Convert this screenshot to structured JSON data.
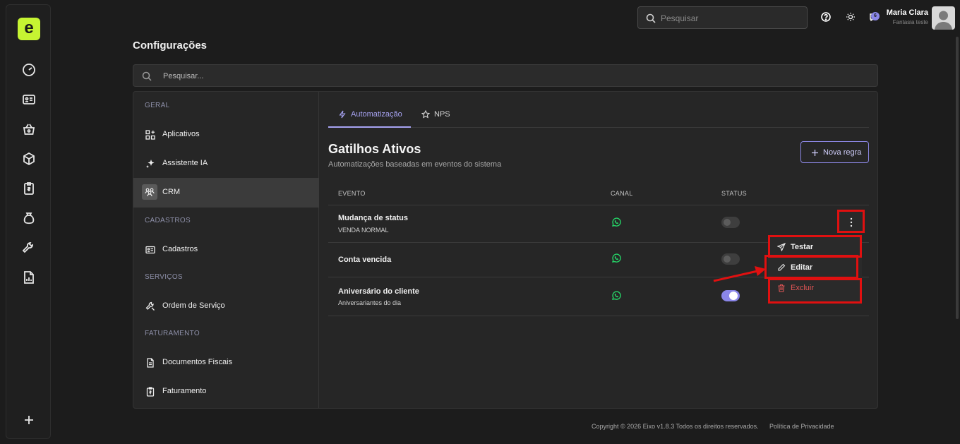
{
  "app": {
    "logo_letter": "e",
    "accent": "#c6f432",
    "purple": "#8a86e8"
  },
  "rail": {
    "items": [
      "dashboard-icon",
      "contact-card-icon",
      "basket-icon",
      "package-icon",
      "receipt-icon",
      "money-bag-icon",
      "wrench-icon",
      "report-icon"
    ],
    "add_icon": "plus-icon"
  },
  "topbar": {
    "search_placeholder": "Pesquisar",
    "notifications_count": "6",
    "user_name": "Maria Clara",
    "user_company": "Fantasia teste"
  },
  "page": {
    "title": "Configurações",
    "search_placeholder": "Pesquisar..."
  },
  "sidebar": {
    "sections": [
      {
        "label": "GERAL",
        "items": [
          {
            "label": "Aplicativos",
            "icon": "apps-icon"
          },
          {
            "label": "Assistente IA",
            "icon": "sparkles-icon"
          },
          {
            "label": "CRM",
            "icon": "users-icon",
            "active": true
          }
        ]
      },
      {
        "label": "CADASTROS",
        "items": [
          {
            "label": "Cadastros",
            "icon": "contact-card-icon"
          }
        ]
      },
      {
        "label": "SERVIÇOS",
        "items": [
          {
            "label": "Ordem de Serviço",
            "icon": "wrench-icon"
          }
        ]
      },
      {
        "label": "FATURAMENTO",
        "items": [
          {
            "label": "Documentos Fiscais",
            "icon": "document-icon"
          },
          {
            "label": "Faturamento",
            "icon": "receipt-icon"
          }
        ]
      }
    ]
  },
  "tabs": [
    {
      "label": "Automatização",
      "icon": "lightning-icon",
      "active": true
    },
    {
      "label": "NPS",
      "icon": "star-icon"
    }
  ],
  "triggers": {
    "title": "Gatilhos Ativos",
    "subtitle": "Automatizações baseadas em eventos do sistema",
    "new_rule_label": "Nova regra",
    "columns": [
      "EVENTO",
      "CANAL",
      "STATUS"
    ],
    "rows": [
      {
        "event": "Mudança de status",
        "detail": "VENDA NORMAL",
        "channel": "whatsapp-icon",
        "active": false
      },
      {
        "event": "Conta vencida",
        "detail": "",
        "channel": "whatsapp-icon",
        "active": false
      },
      {
        "event": "Aniversário do cliente",
        "detail": "Aniversariantes do dia",
        "channel": "whatsapp-icon",
        "active": true
      }
    ]
  },
  "row_menu": {
    "items": [
      {
        "label": "Testar",
        "icon": "send-icon"
      },
      {
        "label": "Editar",
        "icon": "pencil-icon"
      },
      {
        "label": "Excluir",
        "icon": "trash-icon",
        "danger": true
      }
    ]
  },
  "annotation_color": "#e01010",
  "footer": {
    "copyright": "Copyright © 2026 Eixo v1.8.3 Todos os direitos reservados.",
    "privacy": "Política de Privacidade"
  }
}
